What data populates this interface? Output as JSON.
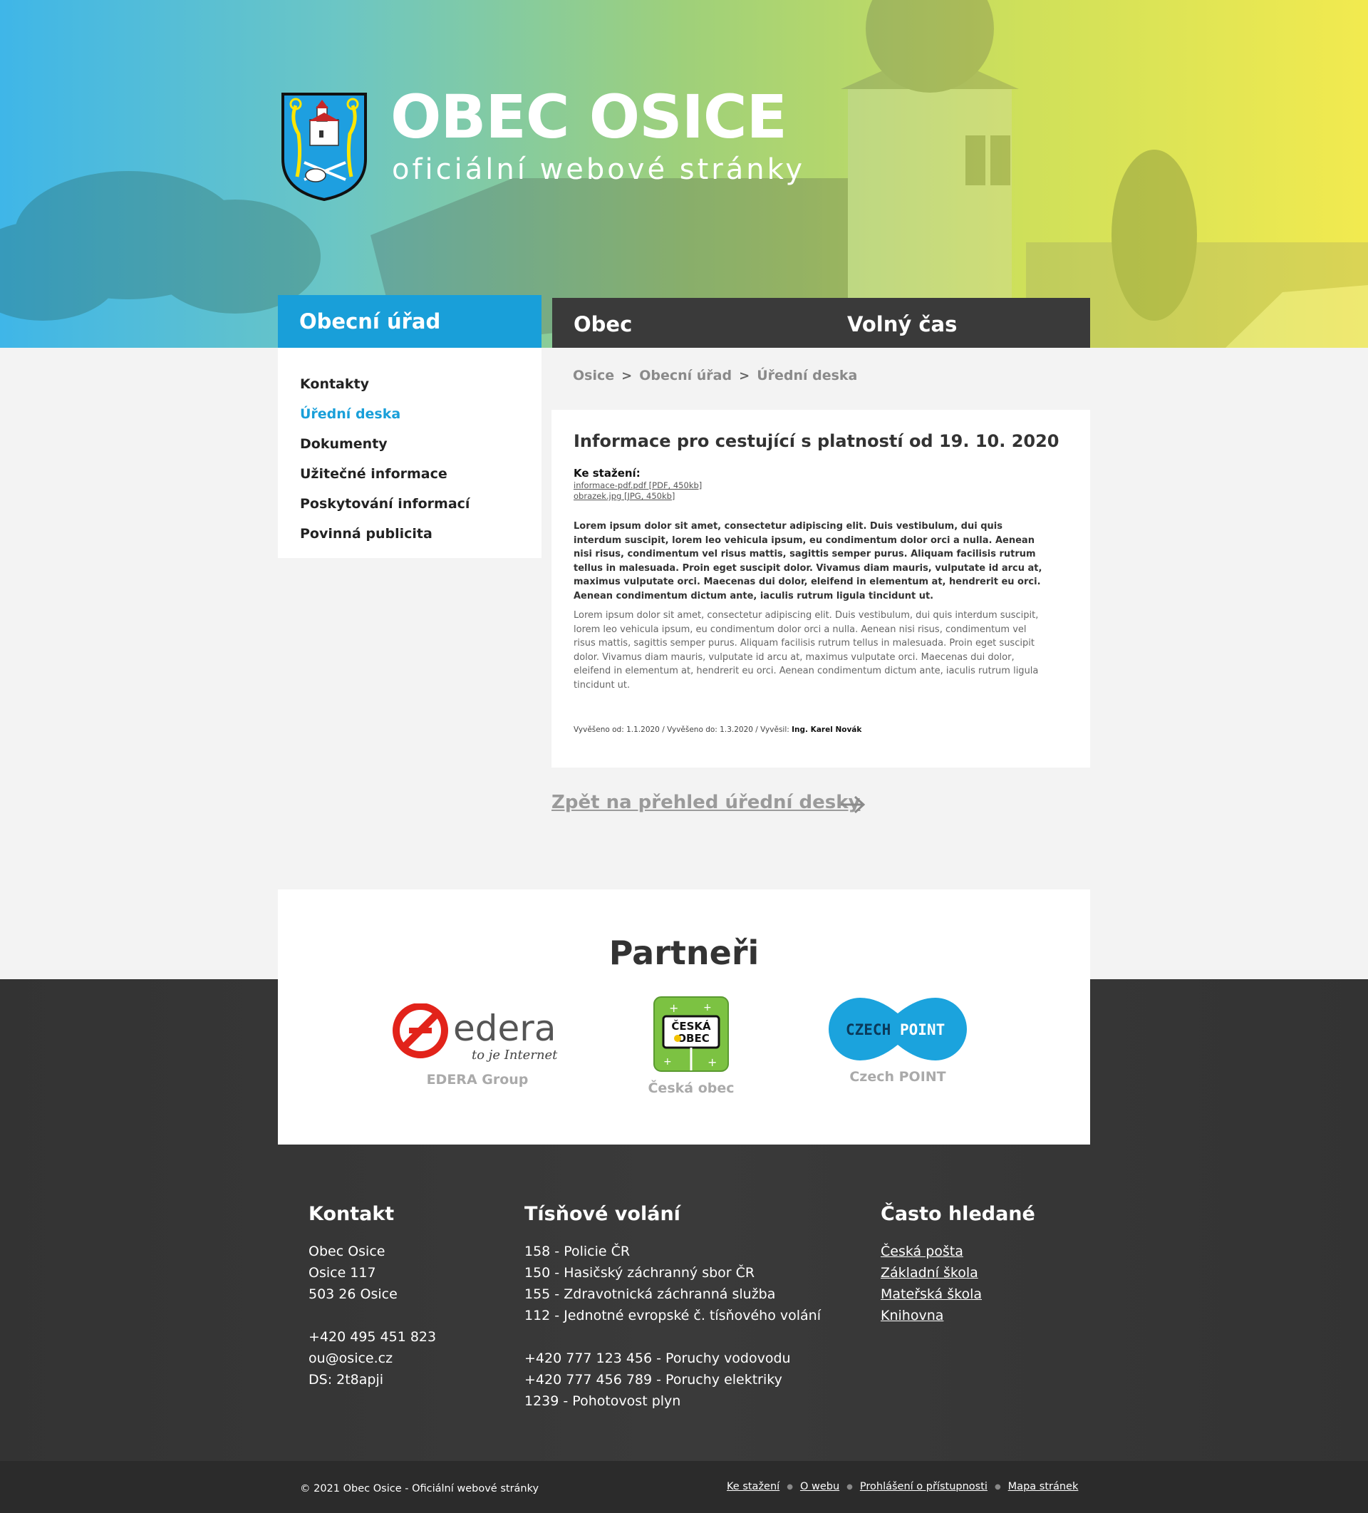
{
  "header": {
    "title": "OBEC OSICE",
    "subtitle": "oficiální webové stránky"
  },
  "nav": {
    "tabs": [
      {
        "label": "Obecní úřad",
        "active": true
      },
      {
        "label": "Obec",
        "active": false
      },
      {
        "label": "Volný čas",
        "active": false
      }
    ]
  },
  "submenu": {
    "items": [
      {
        "label": "Kontakty"
      },
      {
        "label": "Úřední deska",
        "active": true
      },
      {
        "label": "Dokumenty"
      },
      {
        "label": "Užitečné informace"
      },
      {
        "label": "Poskytování informací"
      },
      {
        "label": "Povinná publicita"
      }
    ]
  },
  "breadcrumb": {
    "items": [
      "Osice",
      "Obecní úřad",
      "Úřední deska"
    ],
    "separator": ">"
  },
  "article": {
    "title": "Informace pro cestující s platností od 19. 10. 2020",
    "downloads_label": "Ke stažení:",
    "downloads": [
      "informace-pdf.pdf [PDF, 450kb]",
      "obrazek.jpg [JPG, 450kb]"
    ],
    "lead": "Lorem ipsum dolor sit amet, consectetur adipiscing elit. Duis vestibulum, dui quis interdum suscipit, lorem leo vehicula ipsum, eu condimentum dolor orci a nulla. Aenean nisi risus, condimentum vel risus mattis, sagittis semper purus. Aliquam facilisis rutrum tellus in malesuada. Proin eget suscipit dolor. Vivamus diam mauris, vulputate id arcu at, maximus vulputate orci. Maecenas dui dolor, eleifend in elementum at, hendrerit eu orci. Aenean condimentum dictum ante, iaculis rutrum ligula tincidunt ut.",
    "body": "Lorem ipsum dolor sit amet, consectetur adipiscing elit. Duis vestibulum, dui quis interdum suscipit, lorem leo vehicula ipsum, eu condimentum dolor orci a nulla. Aenean nisi risus, condimentum vel risus mattis, sagittis semper purus. Aliquam facilisis rutrum tellus in malesuada. Proin eget suscipit dolor. Vivamus diam mauris, vulputate id arcu at, maximus vulputate orci. Maecenas dui dolor, eleifend in elementum at, hendrerit eu orci. Aenean condimentum dictum ante, iaculis rutrum ligula tincidunt ut.",
    "meta_from": "Vyvěšeno od: 1.1.2020",
    "meta_to": "Vyvěšeno do: 1.3.2020",
    "meta_by_label": "Vyvěsil:",
    "meta_by": "Ing. Karel Novák"
  },
  "back_link": "Zpět na přehled úřední desky",
  "partners": {
    "title": "Partneři",
    "items": [
      {
        "name": "EDERA Group",
        "logo_text": "edera",
        "logo_tagline": "to je Internet"
      },
      {
        "name": "Česká obec",
        "logo_text_1": "ČESKÁ",
        "logo_text_2": "OBEC"
      },
      {
        "name": "Czech POINT",
        "logo_text_1": "CZECH",
        "logo_text_2": "POINT"
      }
    ]
  },
  "footer": {
    "contact": {
      "heading": "Kontakt",
      "lines_1": [
        "Obec Osice",
        "Osice 117",
        "503 26 Osice"
      ],
      "lines_2": [
        "+420 495 451 823",
        "ou@osice.cz",
        "DS: 2t8apji"
      ]
    },
    "emergency": {
      "heading": "Tísňové volání",
      "lines_1": [
        "158 - Policie ČR",
        "150 - Hasičský záchranný sbor ČR",
        "155 - Zdravotnická záchranná služba",
        "112 - Jednotné evropské č. tísňového volání"
      ],
      "lines_2": [
        "+420 777 123 456 - Poruchy vodovodu",
        "+420 777 456 789 - Poruchy elektriky",
        "1239 - Pohotovost plyn"
      ]
    },
    "frequent": {
      "heading": "Často hledané",
      "links": [
        "Česká pošta",
        "Základní škola",
        "Mateřská škola",
        "Knihovna"
      ]
    }
  },
  "bottom": {
    "copyright": "© 2021 Obec Osice - Oficiální webové stránky",
    "links": [
      "Ke stažení",
      "O webu",
      "Prohlášení o přístupnosti",
      "Mapa stránek"
    ]
  },
  "colors": {
    "accent": "#199fd9",
    "nav_dark": "#3a3a3a",
    "footer": "#333333",
    "edera_red": "#e2231a",
    "czechpoint_blue": "#1ba3dd",
    "ceska_obec_green": "#7cc242"
  }
}
